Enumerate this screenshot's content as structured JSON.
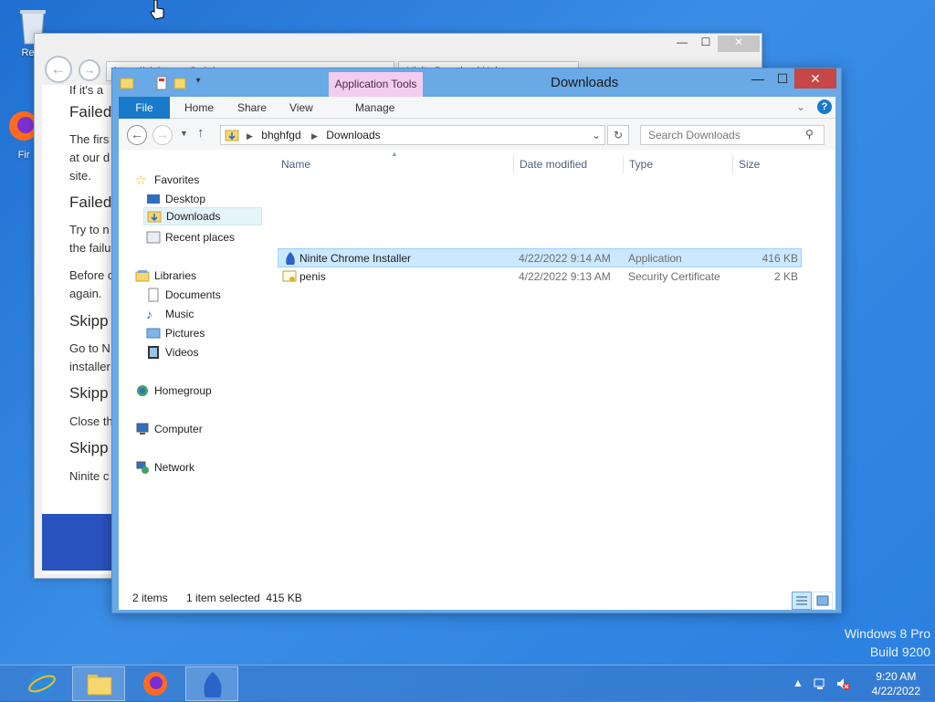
{
  "desktop": {
    "icons": [
      {
        "label": "Recy",
        "icon": "recycle-bin-icon"
      },
      {
        "label": "Fir",
        "icon": "firefox-icon"
      }
    ],
    "watermark": {
      "line1": "Windows 8 Pro",
      "line2": "Build 9200"
    }
  },
  "ie": {
    "address": "https://ninite.com/help/...",
    "tab_title": "Ninite Download Help...",
    "content": {
      "line_top": "If it's a",
      "h1": "Failed",
      "p1a": "The firs",
      "p1b": "at our d",
      "p1c": "site.",
      "h2": "Failed",
      "p2a": "Try to n",
      "p2b": "the failu",
      "p3a": "Before c",
      "p3b": "again.",
      "h3": "Skipp",
      "p4a": "Go to N",
      "p4b": "installer",
      "h4": "Skipp",
      "p5": "Close th",
      "h5": "Skipp",
      "p6": "Ninite c"
    }
  },
  "explorer": {
    "title": "Downloads",
    "context_tab": "Application Tools",
    "ribbon_tabs": [
      "File",
      "Home",
      "Share",
      "View",
      "Manage"
    ],
    "breadcrumb": [
      "bhghfgd",
      "Downloads"
    ],
    "search_placeholder": "Search Downloads",
    "nav": {
      "favorites": "Favorites",
      "desktop": "Desktop",
      "downloads": "Downloads",
      "recent": "Recent places",
      "libraries": "Libraries",
      "documents": "Documents",
      "music": "Music",
      "pictures": "Pictures",
      "videos": "Videos",
      "homegroup": "Homegroup",
      "computer": "Computer",
      "network": "Network"
    },
    "columns": {
      "name": "Name",
      "date": "Date modified",
      "type": "Type",
      "size": "Size"
    },
    "files": [
      {
        "name": "Ninite Chrome Installer",
        "date": "4/22/2022 9:14 AM",
        "type": "Application",
        "size": "416 KB",
        "icon": "ninite-app-icon",
        "selected": true
      },
      {
        "name": "penis",
        "date": "4/22/2022 9:13 AM",
        "type": "Security Certificate",
        "size": "2 KB",
        "icon": "certificate-icon",
        "selected": false
      }
    ],
    "status": {
      "items": "2 items",
      "selection": "1 item selected  415 KB"
    }
  },
  "taskbar": {
    "apps": [
      {
        "icon": "internet-explorer-icon"
      },
      {
        "icon": "file-explorer-icon"
      },
      {
        "icon": "firefox-icon"
      },
      {
        "icon": "ninite-icon"
      }
    ],
    "clock": {
      "time": "9:20 AM",
      "date": "4/22/2022"
    }
  },
  "colors": {
    "accent": "#1979ca",
    "selection": "#cce8ff",
    "context_tab": "#f3cdf0"
  }
}
